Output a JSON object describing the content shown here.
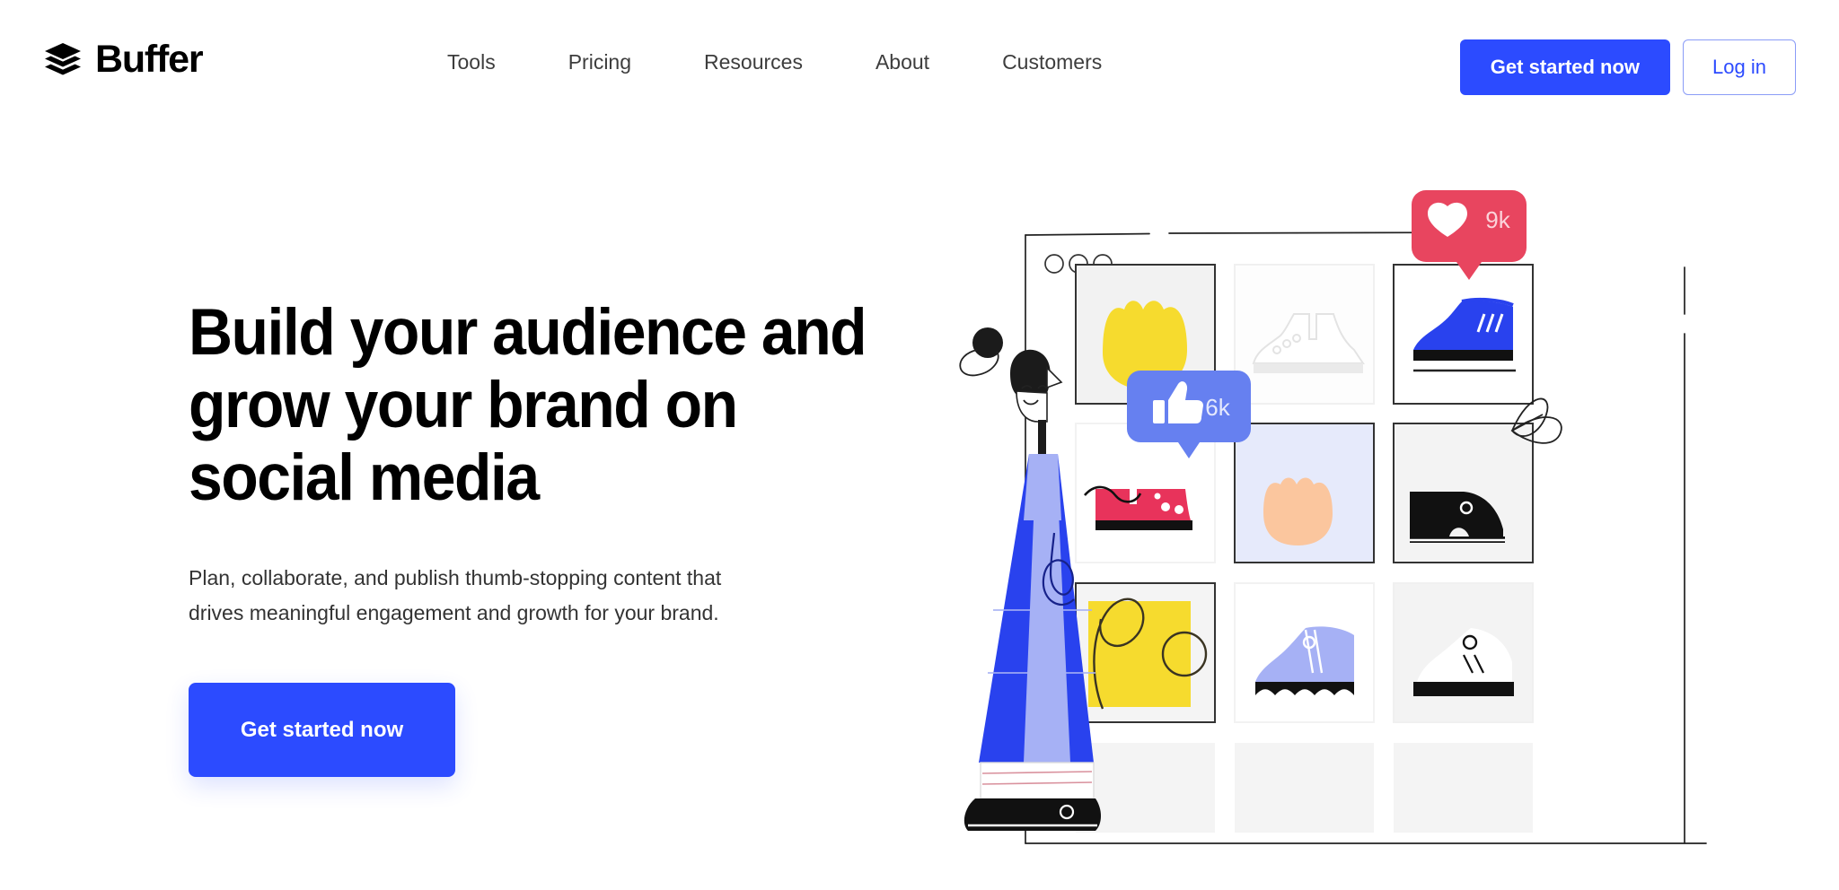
{
  "brand": {
    "name": "Buffer",
    "logo_icon": "stacked-layers-icon",
    "accent_color": "#2C4BFF",
    "heart_badge_color": "#E8455F",
    "like_badge_color": "#6680F0"
  },
  "nav": {
    "items": [
      {
        "label": "Tools"
      },
      {
        "label": "Pricing"
      },
      {
        "label": "Resources"
      },
      {
        "label": "About"
      },
      {
        "label": "Customers"
      }
    ]
  },
  "header_actions": {
    "get_started_label": "Get started now",
    "login_label": "Log in"
  },
  "hero": {
    "title": "Build your audience and grow your brand on social media",
    "subtitle": "Plan, collaborate, and publish thumb-stopping content that drives meaningful engagement and growth for your brand.",
    "cta_label": "Get started now"
  },
  "illustration": {
    "name": "social-media-grid-illustration",
    "window_dots": 3,
    "badges": [
      {
        "icon": "heart-icon",
        "value": "9k",
        "color": "#E8455F"
      },
      {
        "icon": "thumbs-up-icon",
        "value": "6k",
        "color": "#6680F0"
      }
    ],
    "tiles": [
      {
        "row": 1,
        "col": 1,
        "content": "yellow-tulip"
      },
      {
        "row": 1,
        "col": 2,
        "content": "gray-sneaker-outline"
      },
      {
        "row": 1,
        "col": 3,
        "content": "blue-sneaker"
      },
      {
        "row": 2,
        "col": 1,
        "content": "red-shoes"
      },
      {
        "row": 2,
        "col": 2,
        "content": "peach-tulip"
      },
      {
        "row": 2,
        "col": 3,
        "content": "black-boot"
      },
      {
        "row": 3,
        "col": 1,
        "content": "yellow-square-squiggle"
      },
      {
        "row": 3,
        "col": 2,
        "content": "periwinkle-platform-shoe"
      },
      {
        "row": 3,
        "col": 3,
        "content": "white-black-shoe"
      }
    ],
    "character": "person-standing"
  }
}
